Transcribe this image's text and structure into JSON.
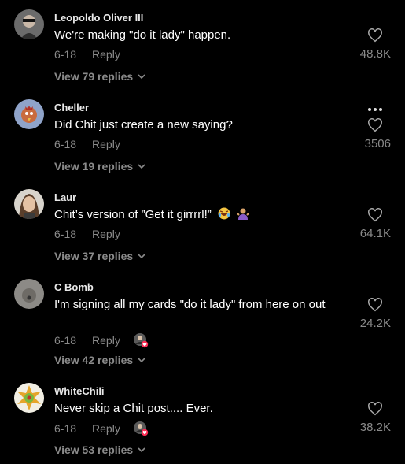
{
  "comments": [
    {
      "username": "Leopoldo Oliver III",
      "text": "We're making \"do it lady\" happen.",
      "date": "6-18",
      "reply": "Reply",
      "likes": "48.8K",
      "view": "View 79 replies"
    },
    {
      "username": "Cheller",
      "text": "Did Chit just create a new saying?",
      "date": "6-18",
      "reply": "Reply",
      "likes": "3506",
      "view": "View 19 replies"
    },
    {
      "username": "Laur",
      "text": "Chit’s version of ”Get it girrrrl!”",
      "date": "6-18",
      "reply": "Reply",
      "likes": "64.1K",
      "view": "View 37 replies"
    },
    {
      "username": "C Bomb",
      "text": "I'm signing all my cards \"do it lady\" from here on out",
      "date": "6-18",
      "reply": "Reply",
      "likes": "24.2K",
      "view": "View 42 replies"
    },
    {
      "username": "WhiteChili",
      "text": "Never skip a Chit post.... Ever.",
      "date": "6-18",
      "reply": "Reply",
      "likes": "38.2K",
      "view": "View 53 replies"
    }
  ],
  "colors": {
    "background": "#000000",
    "muted": "#8a8a8a",
    "creator_badge": "#fe2c55"
  },
  "icons": {
    "like": "heart-icon",
    "more": "more-icon",
    "expand": "chevron-down-icon",
    "creator_liked": "creator-liked-icon"
  }
}
